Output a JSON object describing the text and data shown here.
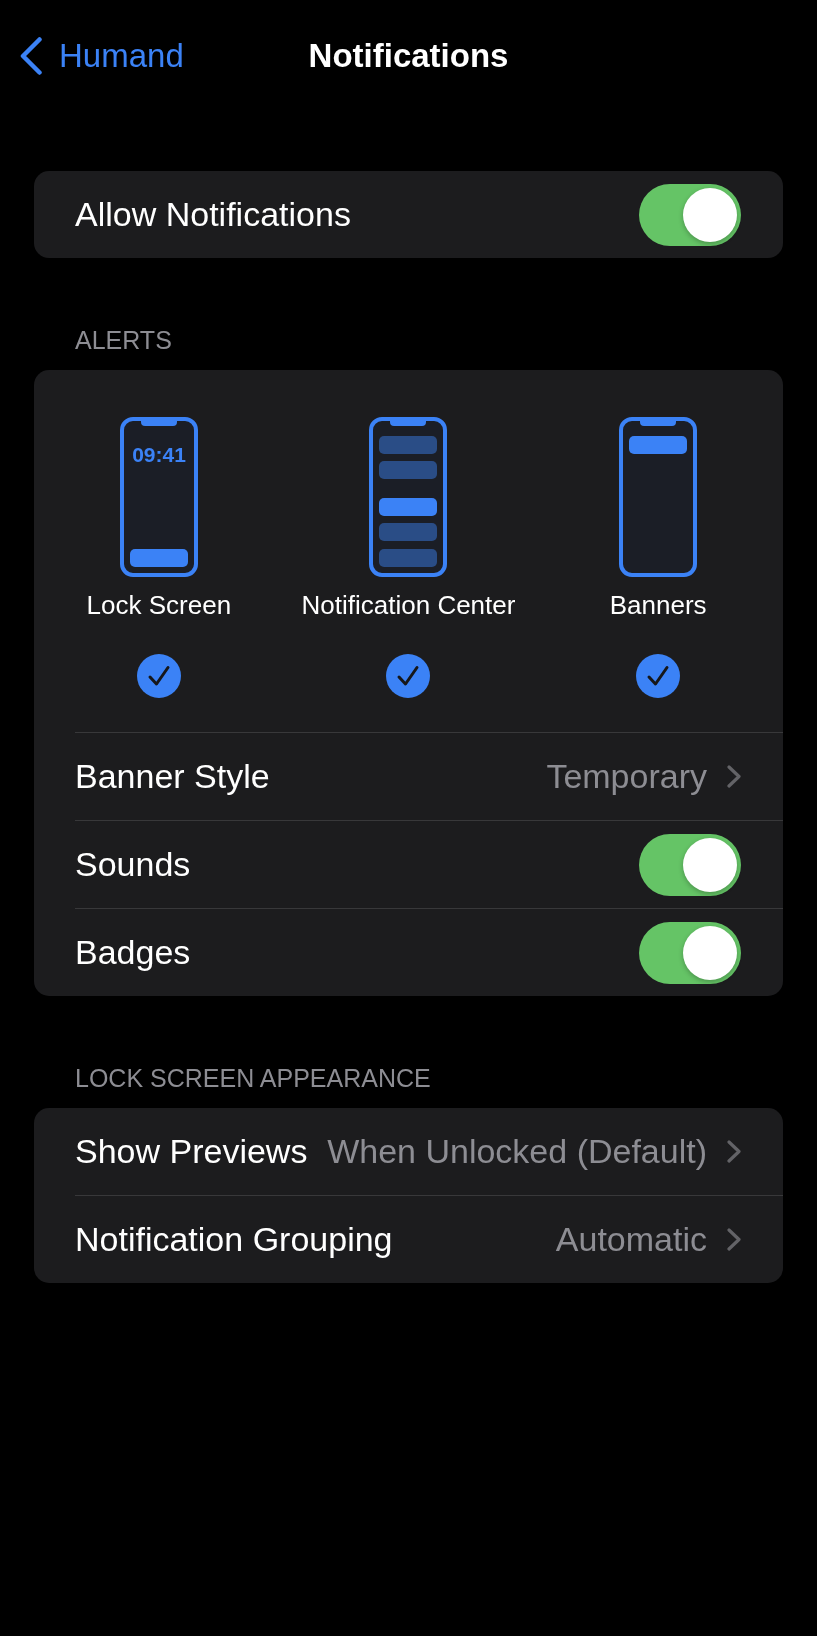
{
  "nav_bar": {
    "back": "Humand",
    "title": "Notifications"
  },
  "groups": [
    {
      "rows": [
        {
          "kind": "toggle",
          "label": "Allow Notifications",
          "on": true
        }
      ]
    },
    {
      "header": "ALERTS",
      "alert_styles": [
        {
          "kind": "lock_screen",
          "label": "Lock Screen",
          "clock": "09:41",
          "checked": true
        },
        {
          "kind": "notification_center",
          "label": "Notification Center",
          "checked": true
        },
        {
          "kind": "banners",
          "label": "Banners",
          "checked": true
        }
      ],
      "rows": [
        {
          "kind": "disclosure",
          "label": "Banner Style",
          "value": "Temporary"
        },
        {
          "kind": "toggle",
          "label": "Sounds",
          "on": true
        },
        {
          "kind": "toggle",
          "label": "Badges",
          "on": true
        }
      ]
    },
    {
      "header": "LOCK SCREEN APPEARANCE",
      "rows": [
        {
          "kind": "disclosure",
          "label": "Show Previews",
          "value": "When Unlocked (Default)"
        },
        {
          "kind": "disclosure",
          "label": "Notification Grouping",
          "value": "Automatic"
        }
      ]
    }
  ]
}
